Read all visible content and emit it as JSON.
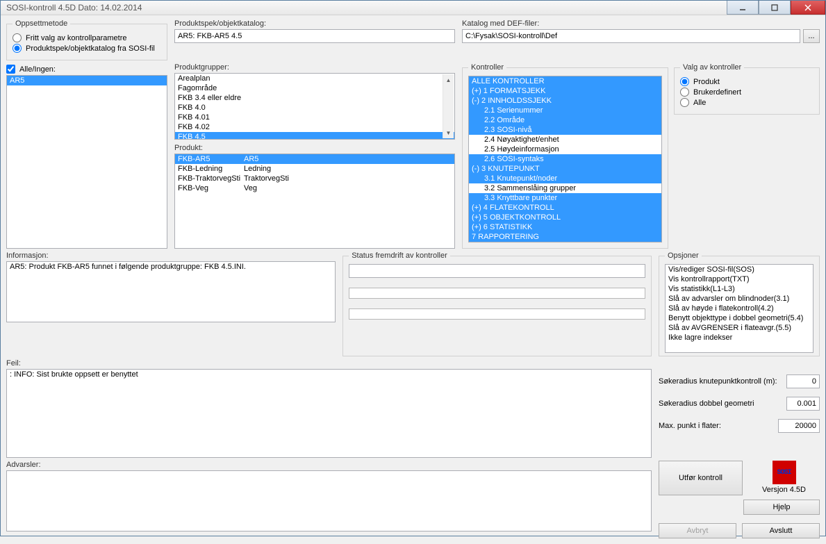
{
  "titlebar": "SOSI-kontroll 4.5D   Dato: 14.02.2014",
  "oppsett": {
    "legend": "Oppsettmetode",
    "opt_fritt": "Fritt valg av kontrollparametre",
    "opt_produkt": "Produktspek/objektkatalog fra SOSI-fil"
  },
  "alleIngen": {
    "label": "Alle/Ingen:",
    "items": [
      "AR5"
    ]
  },
  "prodspek": {
    "label": "Produktspek/objektkatalog:",
    "value": "AR5: FKB-AR5 4.5"
  },
  "produktgrupper": {
    "label": "Produktgrupper:",
    "items": [
      "Arealplan",
      "Fagområde",
      "FKB 3.4 eller eldre",
      "FKB 4.0",
      "FKB 4.01",
      "FKB 4.02",
      "FKB 4.5"
    ],
    "selected": "FKB 4.5"
  },
  "produkt": {
    "label": "Produkt:",
    "rows": [
      {
        "c1": "FKB-AR5",
        "c2": "AR5",
        "sel": true
      },
      {
        "c1": "FKB-Ledning",
        "c2": "Ledning"
      },
      {
        "c1": "FKB-TraktorvegSti",
        "c2": "TraktorvegSti"
      },
      {
        "c1": "FKB-Veg",
        "c2": "Veg"
      }
    ]
  },
  "katalog": {
    "label": "Katalog med DEF-filer:",
    "value": "C:\\Fysak\\SOSI-kontroll\\Def",
    "browse": "..."
  },
  "kontroller": {
    "legend": "Kontroller",
    "items": [
      {
        "t": "ALLE KONTROLLER",
        "hl": true
      },
      {
        "t": "(+) 1 FORMATSJEKK",
        "hl": true
      },
      {
        "t": "(-) 2 INNHOLDSSJEKK",
        "hl": true
      },
      {
        "t": "2.1 Serienummer",
        "hl": true,
        "sub": true
      },
      {
        "t": "2.2 Område",
        "hl": true,
        "sub": true
      },
      {
        "t": "2.3 SOSI-nivå",
        "hl": true,
        "sub": true
      },
      {
        "t": "2.4 Nøyaktighet/enhet",
        "sub": true
      },
      {
        "t": "2.5 Høydeinformasjon",
        "sub": true
      },
      {
        "t": "2.6 SOSI-syntaks",
        "hl": true,
        "sub": true
      },
      {
        "t": "(-) 3 KNUTEPUNKT",
        "hl": true
      },
      {
        "t": "3.1 Knutepunkt/noder",
        "hl": true,
        "sub": true
      },
      {
        "t": "3.2 Sammenslåing grupper",
        "sub": true
      },
      {
        "t": "3.3 Knyttbare punkter",
        "hl": true,
        "sub": true
      },
      {
        "t": "(+) 4 FLATEKONTROLL",
        "hl": true
      },
      {
        "t": "(+) 5 OBJEKTKONTROLL",
        "hl": true
      },
      {
        "t": "(+) 6 STATISTIKK",
        "hl": true
      },
      {
        "t": "7 RAPPORTERING",
        "hl": true
      }
    ]
  },
  "valg": {
    "legend": "Valg av kontroller",
    "opt_produkt": "Produkt",
    "opt_bruker": "Brukerdefinert",
    "opt_alle": "Alle"
  },
  "info": {
    "label": "Informasjon:",
    "text": "AR5: Produkt FKB-AR5 funnet i følgende produktgruppe: FKB 4.5.INI."
  },
  "status": {
    "legend": "Status fremdrift av kontroller"
  },
  "opsjoner": {
    "legend": "Opsjoner",
    "items": [
      "Vis/rediger SOSI-fil(SOS)",
      "Vis kontrollrapport(TXT)",
      "Vis statistikk(L1-L3)",
      "Slå av advarsler om blindnoder(3.1)",
      "Slå av høyde i flatekontroll(4.2)",
      "Benytt objekttype i dobbel geometri(5.4)",
      "Slå av AVGRENSER i flateavgr.(5.5)",
      "Ikke lagre indekser"
    ]
  },
  "feil": {
    "label": "Feil:",
    "text": ": INFO: Sist brukte oppsett er benyttet"
  },
  "params": {
    "sokKnute": {
      "label": "Søkeradius knutepunktkontroll (m):",
      "value": "0"
    },
    "sokDobbel": {
      "label": "Søkeradius dobbel geometri",
      "value": "0.001"
    },
    "maxPunkt": {
      "label": "Max. punkt i flater:",
      "value": "20000"
    }
  },
  "adv": {
    "label": "Advarsler:"
  },
  "btns": {
    "utfor": "Utfør kontroll",
    "versjon": "Versjon 4.5D",
    "hjelp": "Hjelp",
    "avbryt": "Avbryt",
    "avslutt": "Avslutt"
  }
}
